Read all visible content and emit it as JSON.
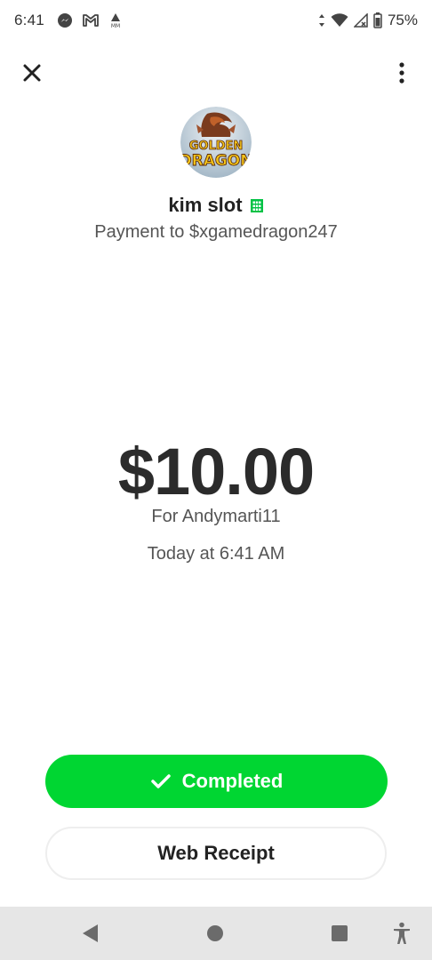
{
  "status_bar": {
    "time": "6:41",
    "battery": "75%",
    "icons": [
      "messenger-icon",
      "gmail-icon",
      "mm-app-icon",
      "data-arrows-icon",
      "wifi-icon",
      "no-signal-icon",
      "battery-icon"
    ]
  },
  "header": {
    "close_icon": "close-icon",
    "menu_icon": "more-vertical-icon",
    "avatar_text_line1": "GOLDEN",
    "avatar_text_line2": "DRAGON",
    "merchant_name": "kim slot",
    "business_icon": "building-icon",
    "payment_to": "Payment to $xgamedragon247"
  },
  "transaction": {
    "amount": "$10.00",
    "note": "For Andymarti11",
    "timestamp": "Today at 6:41 AM"
  },
  "actions": {
    "completed_label": "Completed",
    "web_receipt_label": "Web Receipt"
  },
  "colors": {
    "accent_green": "#00d632",
    "business_icon": "#00c244",
    "nav_bar_bg": "#e6e6e6"
  },
  "nav_bar": {
    "icons": [
      "back-icon",
      "home-icon",
      "recents-icon",
      "accessibility-icon"
    ]
  }
}
